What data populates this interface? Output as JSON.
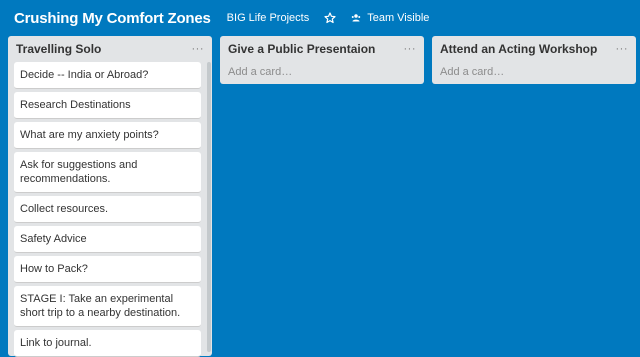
{
  "header": {
    "title": "Crushing My Comfort Zones",
    "org_link": "BIG Life Projects",
    "star_icon": "star-icon",
    "visibility_label": "Team Visible",
    "visibility_icon": "team-icon"
  },
  "lists": [
    {
      "title": "Travelling Solo",
      "menu": "···",
      "cards": [
        "Decide -- India or Abroad?",
        "Research Destinations",
        "What are my anxiety points?",
        "Ask for suggestions and recommendations.",
        "Collect resources.",
        "Safety Advice",
        "How to Pack?",
        "STAGE I: Take an experimental short trip to a nearby destination.",
        "Link to journal."
      ]
    },
    {
      "title": "Give a Public Presentaion",
      "menu": "···",
      "add_card": "Add a card…"
    },
    {
      "title": "Attend an Acting Workshop",
      "menu": "···",
      "add_card": "Add a card…"
    }
  ],
  "colors": {
    "board_bg": "#0079bf",
    "list_bg": "#e2e4e6",
    "card_bg": "#ffffff"
  }
}
